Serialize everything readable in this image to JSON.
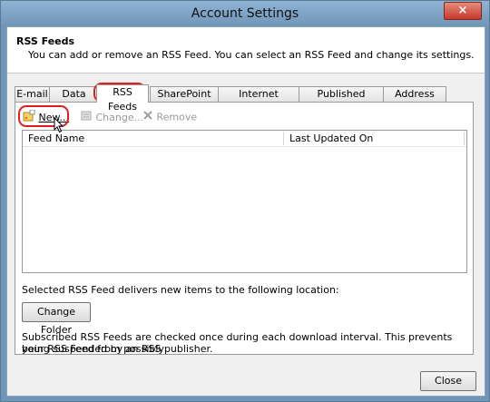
{
  "window": {
    "title": "Account Settings",
    "close_glyph": "×"
  },
  "header": {
    "title": "RSS Feeds",
    "description": "You can add or remove an RSS Feed. You can select an RSS Feed and change its settings."
  },
  "tabs": [
    {
      "label": "E-mail"
    },
    {
      "label": "Data Files"
    },
    {
      "label": "RSS Feeds",
      "active": true
    },
    {
      "label": "SharePoint Lists"
    },
    {
      "label": "Internet Calendars"
    },
    {
      "label": "Published Calendars"
    },
    {
      "label": "Address Books"
    }
  ],
  "toolbar": {
    "new_label": "New...",
    "change_label": "Change...",
    "remove_label": "Remove"
  },
  "list": {
    "columns": [
      "Feed Name",
      "Last Updated On"
    ],
    "rows": []
  },
  "delivery": {
    "text": "Selected RSS Feed delivers new items to the following location:",
    "change_folder_label": "Change Folder"
  },
  "info": {
    "line1": "Subscribed RSS Feeds are checked once during each download interval. This prevents your RSS Feed from possibly",
    "line2": "being suspended by an RSS publisher."
  },
  "footer": {
    "close_label": "Close"
  },
  "colors": {
    "highlight": "#e02020",
    "title_bar": "#6f95b8"
  }
}
